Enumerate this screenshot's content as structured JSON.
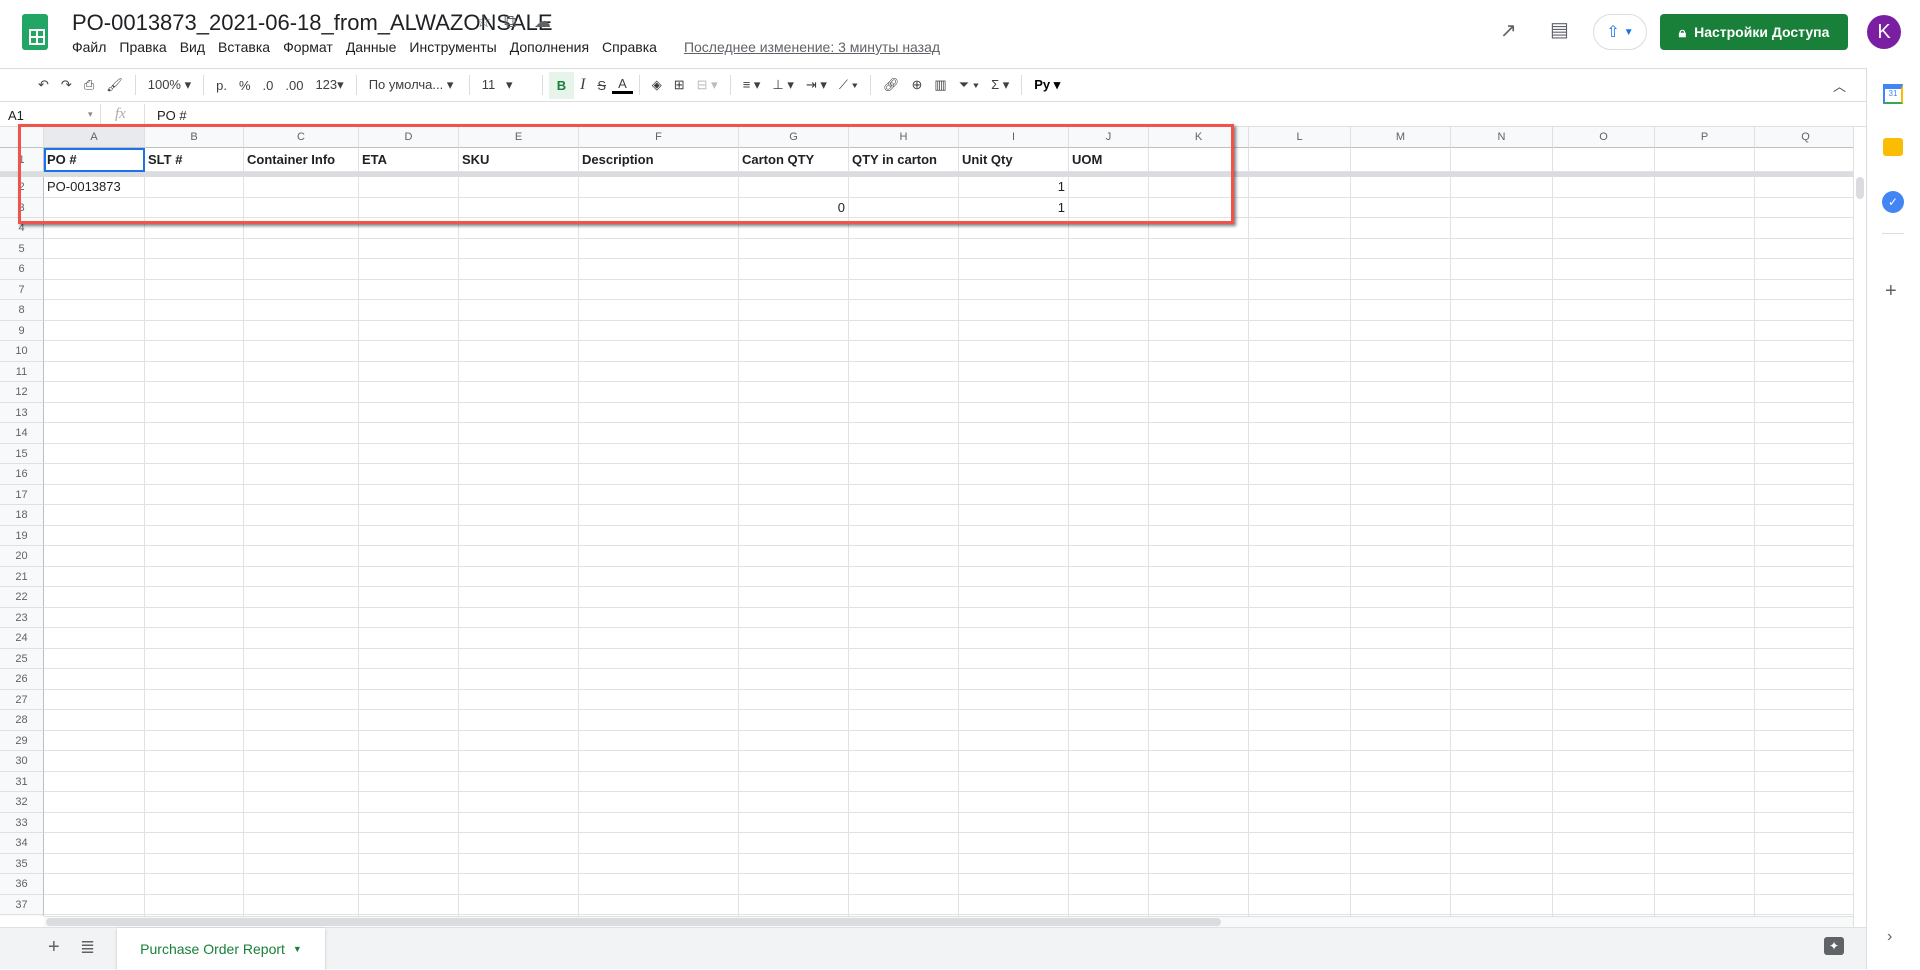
{
  "header": {
    "title": "PO-0013873_2021-06-18_from_ALWAZONSALE",
    "menu": [
      "Файл",
      "Правка",
      "Вид",
      "Вставка",
      "Формат",
      "Данные",
      "Инструменты",
      "Дополнения",
      "Справка"
    ],
    "last_edit": "Последнее изменение: 3 минуты назад",
    "share_label": "Настройки Доступа",
    "avatar_letter": "K"
  },
  "toolbar": {
    "zoom": "100%",
    "currency": "р.",
    "percent": "%",
    "dec_less": ".0",
    "dec_more": ".00",
    "format_more": "123",
    "font": "По умолча...",
    "font_size": "11",
    "bold": "B",
    "italic": "I",
    "strike": "S",
    "text_color": "A",
    "script": "Py"
  },
  "formula_bar": {
    "cell_ref": "A1",
    "fx": "fx",
    "value": "PO #"
  },
  "grid": {
    "columns": [
      "A",
      "B",
      "C",
      "D",
      "E",
      "F",
      "G",
      "H",
      "I",
      "J",
      "K",
      "L",
      "M",
      "N",
      "O",
      "P",
      "Q"
    ],
    "row_count": 37,
    "rows": [
      [
        "PO #",
        "SLT #",
        "Container Info",
        "ETA",
        "SKU",
        "Description",
        "Carton QTY",
        "QTY in carton",
        "Unit Qty",
        "UOM",
        ""
      ],
      [
        "PO-0013873",
        "",
        "",
        "",
        "",
        "",
        "",
        "",
        "1",
        "",
        ""
      ],
      [
        "",
        "",
        "",
        "",
        "",
        "",
        "0",
        "",
        "1",
        "",
        ""
      ]
    ]
  },
  "sheets": [
    {
      "name": "Purchase Order Report",
      "active": true
    }
  ]
}
